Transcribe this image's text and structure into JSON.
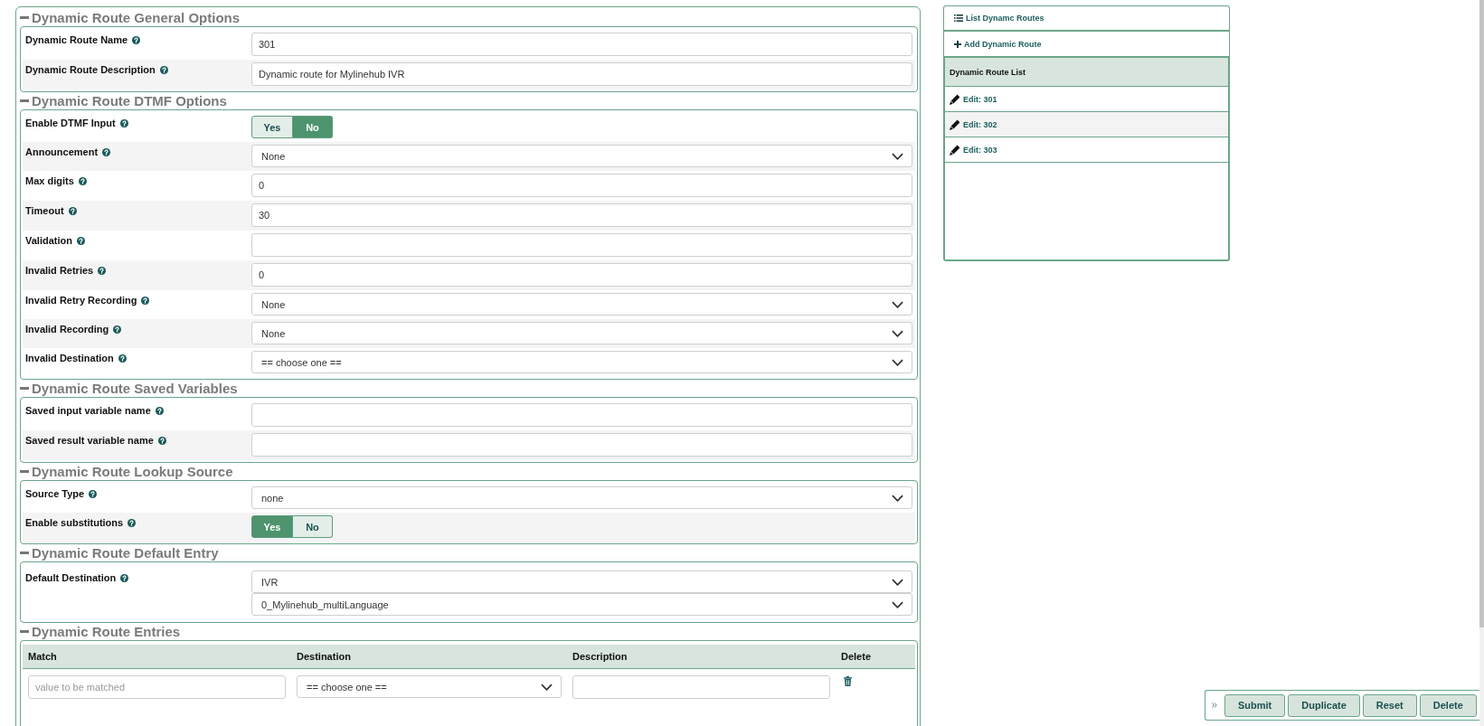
{
  "sections": [
    {
      "kind": "form",
      "title": "Dynamic Route General Options",
      "expanded": true,
      "rows": [
        {
          "kind": "input",
          "label": "Dynamic Route Name",
          "value": "301"
        },
        {
          "kind": "input",
          "label": "Dynamic Route Description",
          "value": "Dynamic route for Mylinehub IVR"
        }
      ]
    },
    {
      "kind": "form",
      "title": "Dynamic Route DTMF Options",
      "expanded": true,
      "rows": [
        {
          "kind": "toggle",
          "label": "Enable DTMF Input",
          "options": [
            {
              "label": "Yes",
              "selected": false
            },
            {
              "label": "No",
              "selected": true
            }
          ]
        },
        {
          "kind": "select",
          "label": "Announcement",
          "value": "None"
        },
        {
          "kind": "input",
          "label": "Max digits",
          "value": "0"
        },
        {
          "kind": "input",
          "label": "Timeout",
          "value": "30"
        },
        {
          "kind": "input",
          "label": "Validation"
        },
        {
          "kind": "input",
          "label": "Invalid Retries",
          "value": "0"
        },
        {
          "kind": "select",
          "label": "Invalid Retry Recording",
          "value": "None"
        },
        {
          "kind": "select",
          "label": "Invalid Recording",
          "value": "None"
        },
        {
          "kind": "select",
          "label": "Invalid Destination",
          "value": "== choose one =="
        }
      ]
    },
    {
      "kind": "form",
      "title": "Dynamic Route Saved Variables",
      "expanded": true,
      "rows": [
        {
          "kind": "input",
          "label": "Saved input variable name"
        },
        {
          "kind": "input",
          "label": "Saved result variable name"
        }
      ]
    },
    {
      "kind": "form",
      "title": "Dynamic Route Lookup Source",
      "expanded": true,
      "rows": [
        {
          "kind": "select",
          "label": "Source Type",
          "value": "none"
        },
        {
          "kind": "toggle",
          "label": "Enable substitutions",
          "options": [
            {
              "label": "Yes",
              "selected": true
            },
            {
              "label": "No",
              "selected": false
            }
          ]
        }
      ]
    },
    {
      "kind": "form",
      "title": "Dynamic Route Default Entry",
      "expanded": true,
      "rows": [
        {
          "kind": "selects",
          "label": "Default Destination",
          "values": [
            "IVR",
            "0_Mylinehub_multiLanguage"
          ]
        }
      ]
    },
    {
      "kind": "table",
      "title": "Dynamic Route Entries",
      "expanded": true,
      "columns": [
        "Match",
        "Destination",
        "Description",
        "Delete"
      ],
      "rows": [
        {
          "cells": [
            {
              "kind": "input",
              "placeholder": "value to be matched"
            },
            {
              "kind": "select",
              "value": "== choose one =="
            },
            {
              "kind": "input"
            },
            {
              "kind": "delete"
            }
          ]
        }
      ]
    }
  ],
  "sidebar": {
    "links": [
      {
        "kind": "list",
        "label": "List Dynamc Routes"
      },
      {
        "kind": "add",
        "label": "Add Dynamic Route"
      }
    ],
    "list": {
      "title": "Dynamic Route List",
      "items": [
        {
          "label": "Edit: 301"
        },
        {
          "label": "Edit: 302"
        },
        {
          "label": "Edit: 303"
        }
      ]
    }
  },
  "actions": [
    "Submit",
    "Duplicate",
    "Reset",
    "Delete"
  ]
}
